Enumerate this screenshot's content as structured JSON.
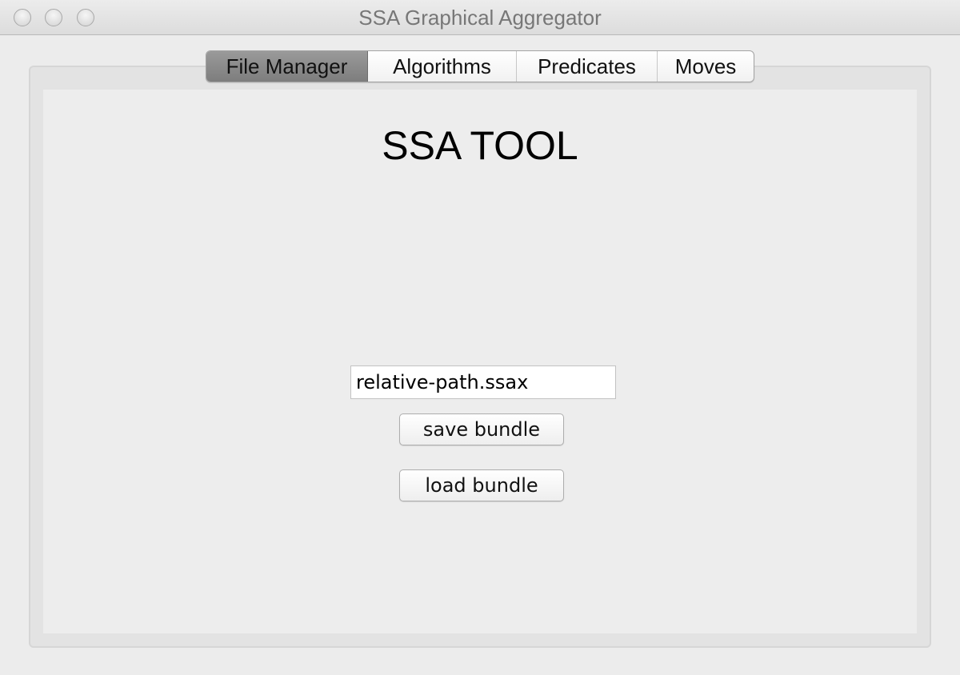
{
  "window": {
    "title": "SSA Graphical Aggregator"
  },
  "tabs": [
    {
      "label": "File Manager",
      "selected": true
    },
    {
      "label": "Algorithms",
      "selected": false
    },
    {
      "label": "Predicates",
      "selected": false
    },
    {
      "label": "Moves",
      "selected": false
    }
  ],
  "file_manager": {
    "heading": "SSA TOOL",
    "path_value": "relative-path.ssax",
    "save_label": "save bundle",
    "load_label": "load bundle"
  },
  "colors": {
    "window_bg": "#ececec",
    "selected_tab": "#8a8a8a",
    "title_text": "#777777"
  }
}
